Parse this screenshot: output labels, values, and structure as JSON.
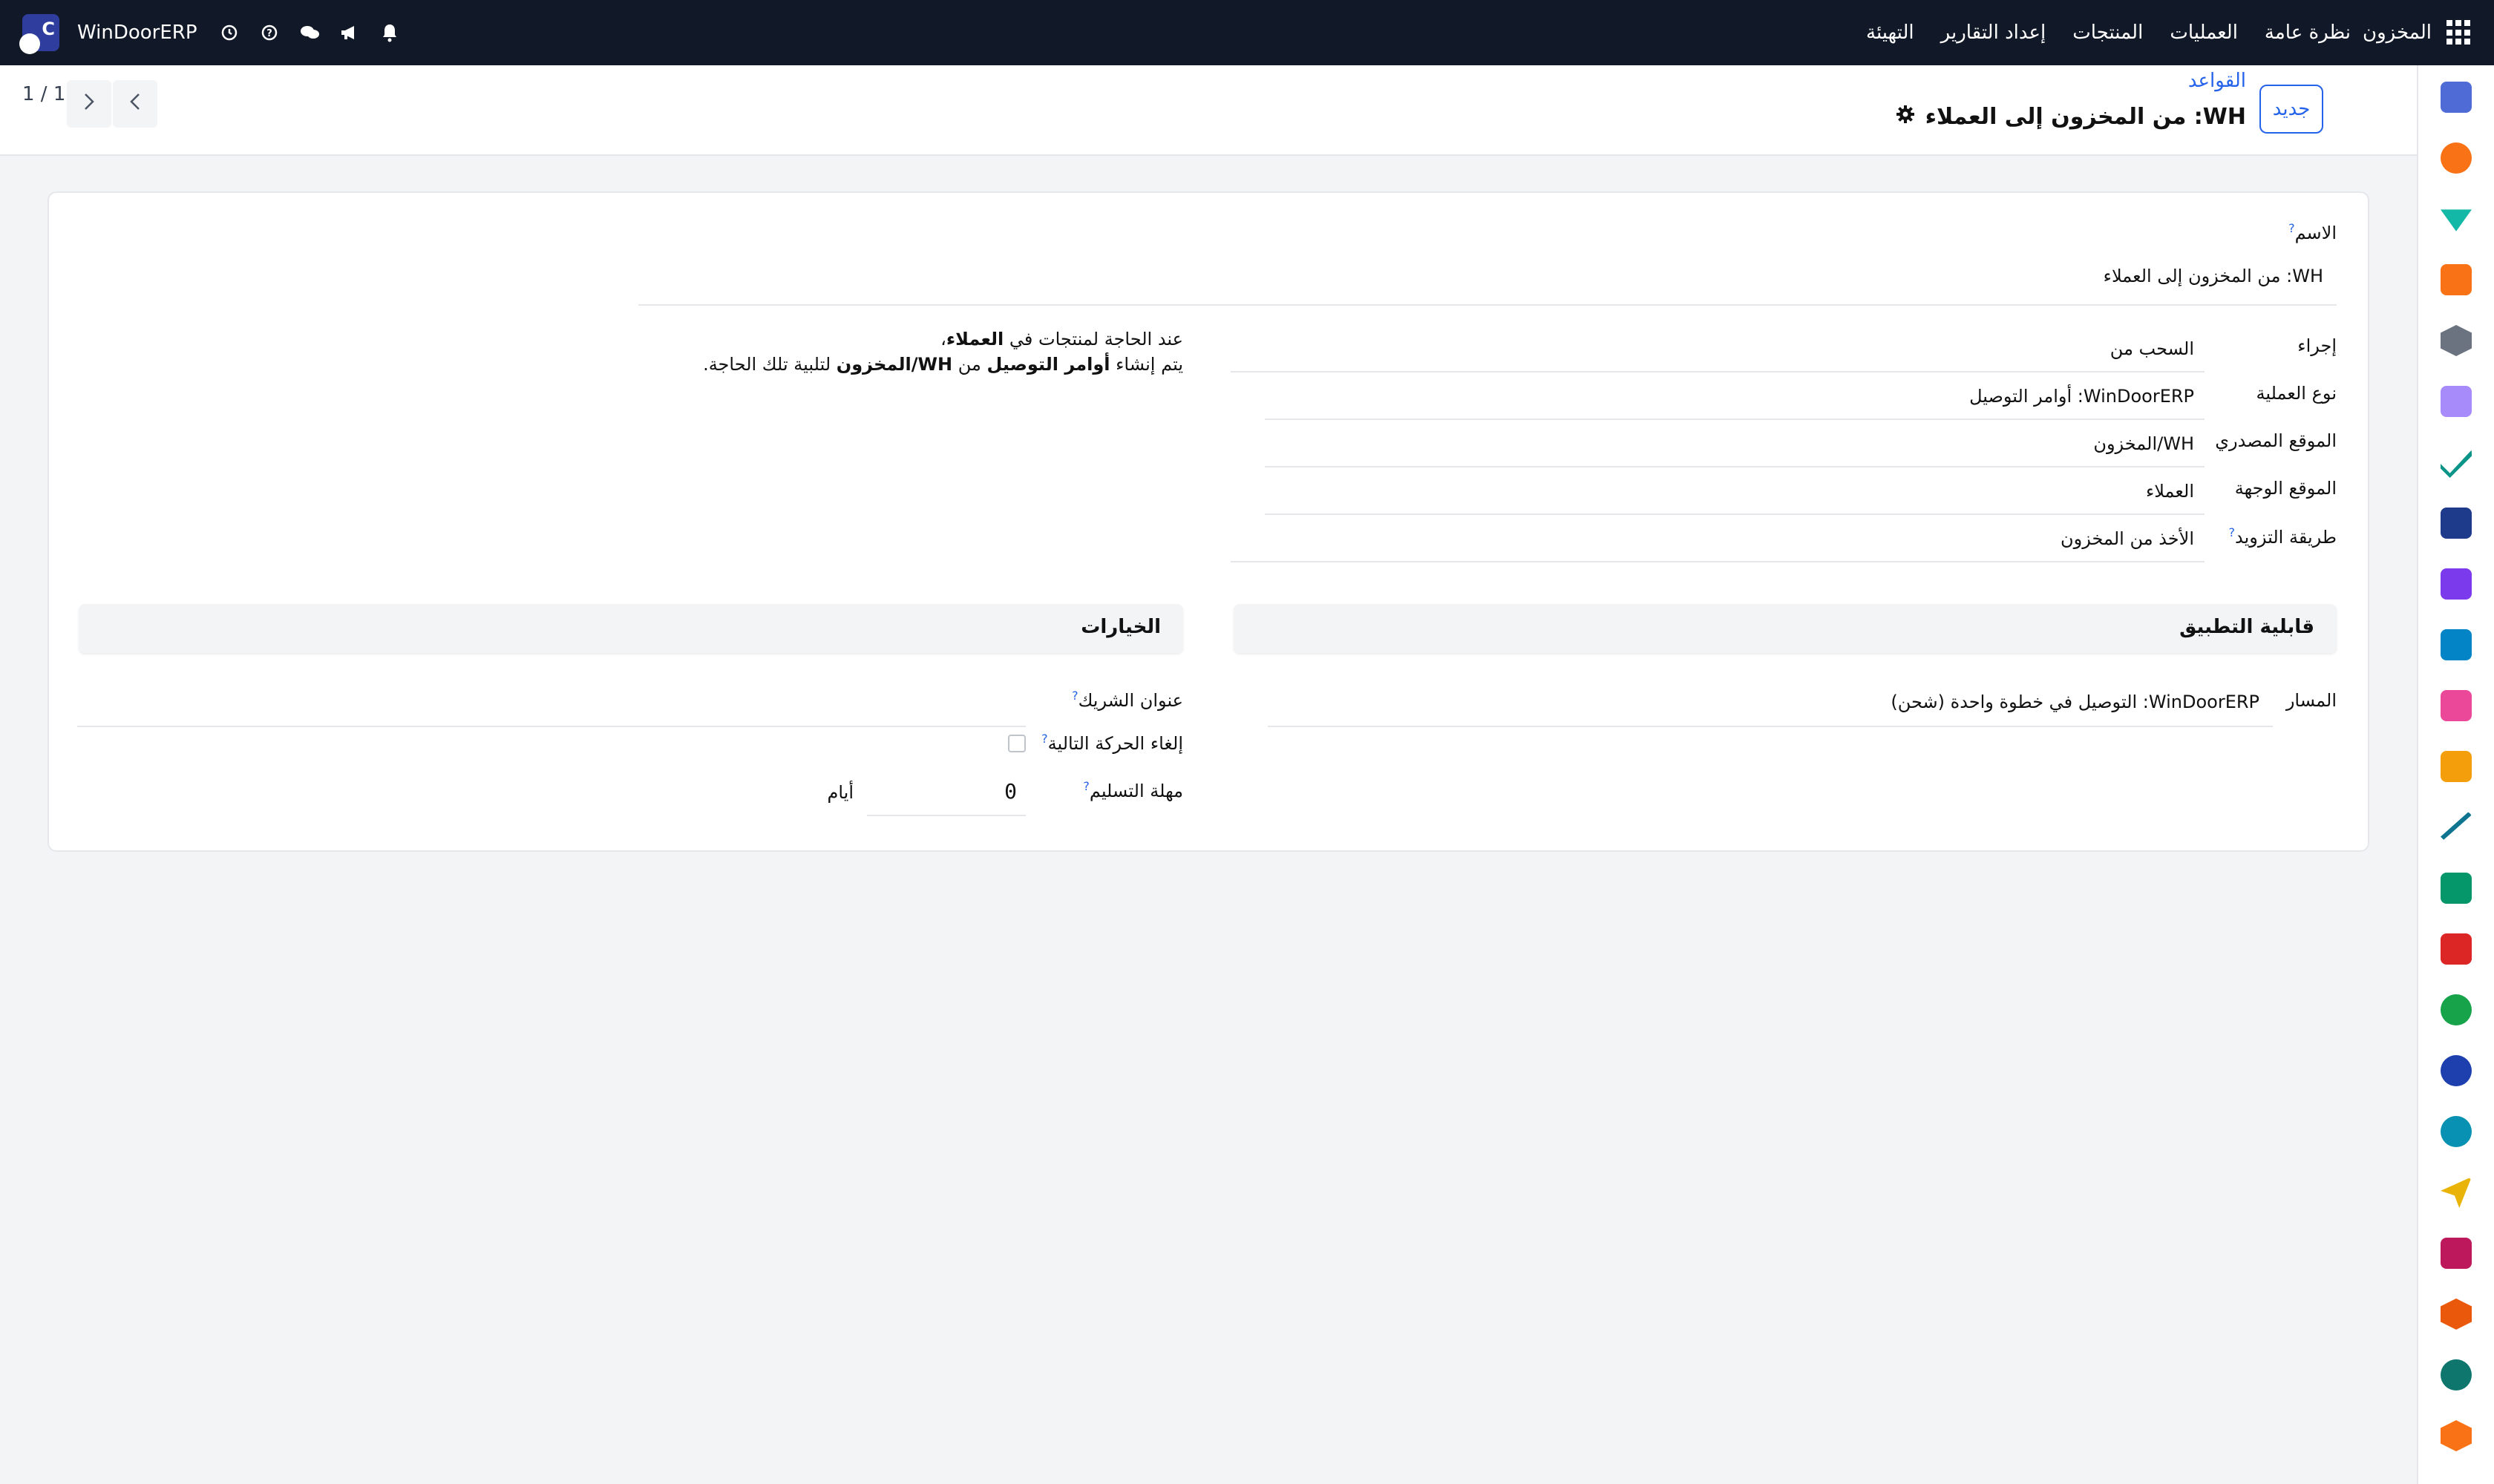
{
  "navbar": {
    "brand": "WinDoorERP",
    "menu": [
      "المخزون",
      "نظرة عامة",
      "العمليات",
      "المنتجات",
      "إعداد التقارير",
      "التهيئة"
    ],
    "system_icons": [
      "clock-icon",
      "help-icon",
      "chat-icon",
      "megaphone-icon",
      "bell-icon"
    ]
  },
  "control_panel": {
    "pager": "1 / 1",
    "new_button": "جديد",
    "breadcrumb": "القواعد",
    "record_title": "WH: من المخزون إلى العملاء"
  },
  "form": {
    "name_label": "الاسم",
    "name_value": "WH: من المخزون إلى العملاء",
    "action_label": "إجراء",
    "action_value": "السحب من",
    "operation_type_label": "نوع العملية",
    "operation_type_value": "WinDoorERP: أوامر التوصيل",
    "source_location_label": "الموقع المصدري",
    "source_location_value": "WH/المخزون",
    "dest_location_label": "الموقع الوجهة",
    "dest_location_value": "العملاء",
    "supply_method_label": "طريقة التزويد",
    "supply_method_value": "الأخذ من المخزون",
    "help_line1_a": "عند الحاجة لمنتجات في ",
    "help_line1_b": "العملاء",
    "help_line1_c": "،",
    "help_line2_a": "يتم إنشاء ",
    "help_line2_b": "أوامر التوصيل",
    "help_line2_c": " من ",
    "help_line2_d": "WH/المخزون",
    "help_line2_e": " لتلبية تلك الحاجة.",
    "applicability_title": "قابلية التطبيق",
    "options_title": "الخيارات",
    "route_label": "المسار",
    "route_value": "WinDoorERP: التوصيل في خطوة واحدة (شحن)",
    "partner_address_label": "عنوان الشريك",
    "partner_address_value": "",
    "cancel_next_label": "إلغاء الحركة التالية",
    "lead_time_label": "مهلة التسليم",
    "lead_time_value": "0",
    "lead_time_unit": "أيام"
  },
  "help_marker": "?",
  "accent_color": "#2563eb"
}
